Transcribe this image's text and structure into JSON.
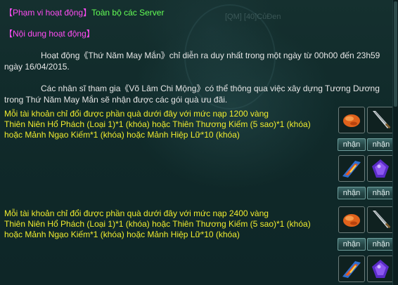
{
  "event": {
    "scope_label": "【Phạm vi hoạt động】",
    "scope_value": "Toàn bộ các Server",
    "content_label": "【Nội dung hoạt động】",
    "desc_line1": "Hoạt động《Thứ Năm May Mắn》chỉ diễn ra duy nhất trong một ngày từ 00h00 đến 23h59",
    "desc_line2": "ngày 16/04/2015.",
    "desc_line3": "Các nhân sĩ tham gia《Võ Lâm Chi Mộng》có thể thông qua việc xây dựng Tương Dương",
    "desc_line4": "trong Thứ Năm May Mắn sẽ nhận được các gói quà ưu đãi."
  },
  "background": {
    "faint_text": "[QM] [40]CủĐen"
  },
  "tiers": [
    {
      "line1": "Mỗi tài khoản chỉ đổi được phần quà dưới đây với mức nạp 1200 vàng",
      "line2": "Thiên Niên Hổ Phách (Loại 1)*1 (khóa) hoặc Thiên Thương Kiếm (5 sao)*1 (khóa)",
      "line3": "hoặc Mảnh Ngạo Kiếm*1 (khóa) hoặc Mảnh Hiệp Lữ*10 (khóa)",
      "claim_label_1": "nhận",
      "claim_label_2": "nhận",
      "items": [
        "amber-stone-icon",
        "sword-icon",
        "blade-fragment-icon",
        "purple-gem-icon"
      ]
    },
    {
      "line1": "Mỗi tài khoản chỉ đổi được phần quà dưới đây với mức nạp 2400 vàng",
      "line2": "Thiên Niên Hổ Phách (Loại 1)*1 (khóa) hoặc Thiên Thương Kiếm (5 sao)*1 (khóa)",
      "line3": "hoặc Mảnh Ngạo Kiếm*1 (khóa) hoặc Mảnh Hiệp Lữ*10 (khóa)",
      "claim_label_1": "nhận",
      "claim_label_2": "nhận",
      "items": [
        "amber-stone-icon",
        "sword-icon",
        "blade-fragment-icon",
        "purple-gem-icon"
      ]
    }
  ],
  "colors": {
    "label_magenta": "#ff4cf3",
    "value_green": "#63ff55",
    "tier_yellow": "#f0ec2e",
    "body_text": "#e6e6e6"
  }
}
